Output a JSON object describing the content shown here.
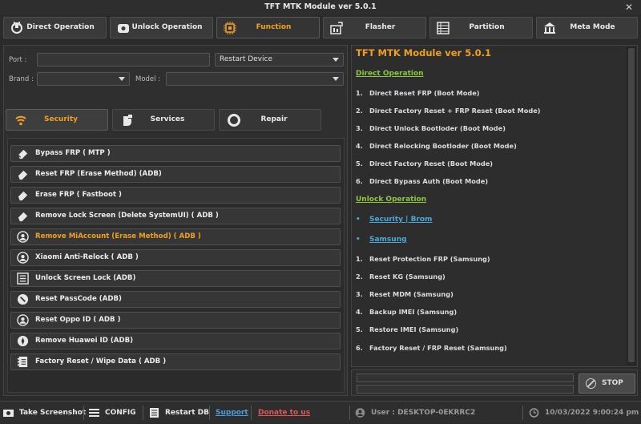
{
  "window": {
    "title": "TFT MTK Module ver 5.0.1",
    "close_glyph": "✕"
  },
  "topnav": [
    {
      "label": "Direct Operation",
      "icon": "plug-icon",
      "active": false
    },
    {
      "label": "Unlock Operation",
      "icon": "unlock-icon",
      "active": false
    },
    {
      "label": "Function",
      "icon": "chip-icon",
      "active": true
    },
    {
      "label": "Flasher",
      "icon": "flasher-icon",
      "active": false
    },
    {
      "label": "Partition",
      "icon": "partition-icon",
      "active": false
    },
    {
      "label": "Meta Mode",
      "icon": "meta-icon",
      "active": false
    }
  ],
  "form": {
    "port_label": "Port :",
    "port_value": "",
    "mode_select": "Restart Device",
    "brand_label": "Brand :",
    "brand_value": "",
    "model_label": "Model :",
    "model_value": ""
  },
  "tabs": [
    {
      "label": "Security",
      "active": true
    },
    {
      "label": "Services",
      "active": false
    },
    {
      "label": "Repair",
      "active": false
    }
  ],
  "functions": [
    {
      "label": "Bypass FRP ( MTP )",
      "icon": "eraser-icon"
    },
    {
      "label": "Reset FRP (Erase Method) (ADB)",
      "icon": "eraser-icon"
    },
    {
      "label": "Erase FRP ( Fastboot )",
      "icon": "eraser-icon"
    },
    {
      "label": "Remove Lock Screen (Delete SystemUI) ( ADB )",
      "icon": "eraser-icon"
    },
    {
      "label": "Remove MiAccount (Erase Method) ( ADB )",
      "icon": "account-icon",
      "highlight": true
    },
    {
      "label": "Xiaomi Anti-Relock ( ADB )",
      "icon": "account-icon"
    },
    {
      "label": "Unlock Screen Lock (ADB)",
      "icon": "list-icon"
    },
    {
      "label": "Reset PassCode (ADB)",
      "icon": "reset-icon"
    },
    {
      "label": "Reset Oppo ID ( ADB )",
      "icon": "account-icon"
    },
    {
      "label": "Remove Huawei ID (ADB)",
      "icon": "huawei-icon"
    },
    {
      "label": "Factory Reset / Wipe Data ( ADB )",
      "icon": "book-icon"
    }
  ],
  "log": {
    "title": "TFT MTK Module ver 5.0.1",
    "sections": [
      {
        "heading": "Direct Operation",
        "items": [
          "Direct Reset FRP (Boot Mode)",
          "Direct Factory Reset + FRP Reset (Boot Mode)",
          "Direct Unlock Bootloder (Boot Mode)",
          "Direct Relocking Bootloder (Boot Mode)",
          "Direct Factory Reset (Boot Mode)",
          "Direct Bypass Auth (Boot Mode)"
        ]
      },
      {
        "heading": "Unlock Operation",
        "bullets": [
          "Security | Brom",
          "Samsung"
        ],
        "items": [
          "Reset Protection FRP (Samsung)",
          "Reset KG (Samsung)",
          "Reset MDM (Samsung)",
          "Backup IMEI (Samsung)",
          "Restore IMEI (Samsung)",
          "Factory Reset / FRP Reset (Samsung)"
        ]
      }
    ]
  },
  "progress": {
    "bar1": 0,
    "bar2": 0,
    "stop_label": "STOP"
  },
  "statusbar": {
    "screenshot": "Take Screenshot",
    "config": "CONFIG",
    "restart_db": "Restart DB",
    "support": "Support",
    "donate": "Donate to us",
    "user": "User : DESKTOP-0EKRRC2",
    "datetime": "10/03/2022 9:00:24 pm"
  },
  "colors": {
    "accent": "#f0a020",
    "heading_green": "#8dc63f",
    "link_blue": "#4a9de0",
    "link_red": "#e05555"
  }
}
